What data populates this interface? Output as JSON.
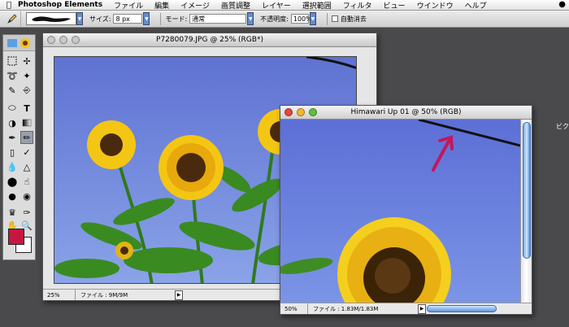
{
  "menubar": {
    "app_name": "Photoshop Elements",
    "items": [
      "ファイル",
      "編集",
      "イメージ",
      "画質調整",
      "レイヤー",
      "選択範囲",
      "フィルタ",
      "ビュー",
      "ウインドウ",
      "ヘルプ"
    ]
  },
  "options_bar": {
    "size_label": "サイズ:",
    "size_value": "8 px",
    "mode_label": "モード:",
    "mode_value": "通常",
    "opacity_label": "不透明度:",
    "opacity_value": "100%",
    "auto_erase_label": "自動消去"
  },
  "colors": {
    "foreground": "#c61742",
    "background": "#ffffff",
    "arrow": "#c2185b"
  },
  "window1": {
    "title": "P7280079.JPG @ 25% (RGB*)",
    "zoom": "25%",
    "file_info": "ファイル : 9M/9M"
  },
  "window2": {
    "title": "Himawari  Up 01 @ 50% (RGB)",
    "zoom": "50%",
    "file_info": "ファイル : 1.83M/1.83M"
  },
  "background_text": {
    "edge_label": "ビク"
  }
}
